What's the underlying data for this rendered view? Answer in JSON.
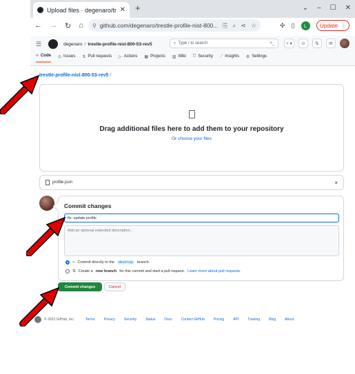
{
  "browser": {
    "tab_title": "Upload files · degenaro/tr",
    "url": "github.com/degenaro/trestle-profile-nist-800...",
    "profile_initial": "L",
    "update_label": "Update"
  },
  "github": {
    "owner": "degenaro",
    "repo": "trestle-profile-nist-800-53-rev5",
    "search_placeholder": "Type / to search",
    "tabs": [
      {
        "label": "Code",
        "icon": "‹›"
      },
      {
        "label": "Issues",
        "icon": "⊙"
      },
      {
        "label": "Pull requests",
        "icon": "⇅"
      },
      {
        "label": "Actions",
        "icon": "▷"
      },
      {
        "label": "Projects",
        "icon": "▦"
      },
      {
        "label": "Wiki",
        "icon": "▥"
      },
      {
        "label": "Security",
        "icon": "⛉"
      },
      {
        "label": "Insights",
        "icon": "⟋"
      },
      {
        "label": "Settings",
        "icon": "⚙"
      }
    ]
  },
  "page": {
    "breadcrumb_repo": "trestle-profile-nist-800-53-rev5",
    "breadcrumb_sep": "/",
    "dropzone_title": "Drag additional files here to add them to your repository",
    "dropzone_or": "Or",
    "dropzone_link": "choose your files"
  },
  "file": {
    "name": "profile.json",
    "remove": "×"
  },
  "commit": {
    "title": "Commit changes",
    "message": "fix: update profile",
    "description_placeholder": "Add an optional extended description...",
    "option1_pre": "Commit directly to the",
    "option1_branch": "develop",
    "option1_post": "branch.",
    "option2_pre": "Create a",
    "option2_bold": "new branch",
    "option2_post": "for this commit and start a pull request.",
    "option2_link": "Learn more about pull requests.",
    "commit_button": "Commit changes",
    "cancel_button": "Cancel"
  },
  "footer": {
    "copyright": "© 2023 GitHub, Inc.",
    "links": [
      "Terms",
      "Privacy",
      "Security",
      "Status",
      "Docs",
      "Contact GitHub",
      "Pricing",
      "API",
      "Training",
      "Blog",
      "About"
    ]
  },
  "colors": {
    "arrow": "#e00000",
    "commit_green": "#1f883d",
    "link_blue": "#0969da"
  }
}
